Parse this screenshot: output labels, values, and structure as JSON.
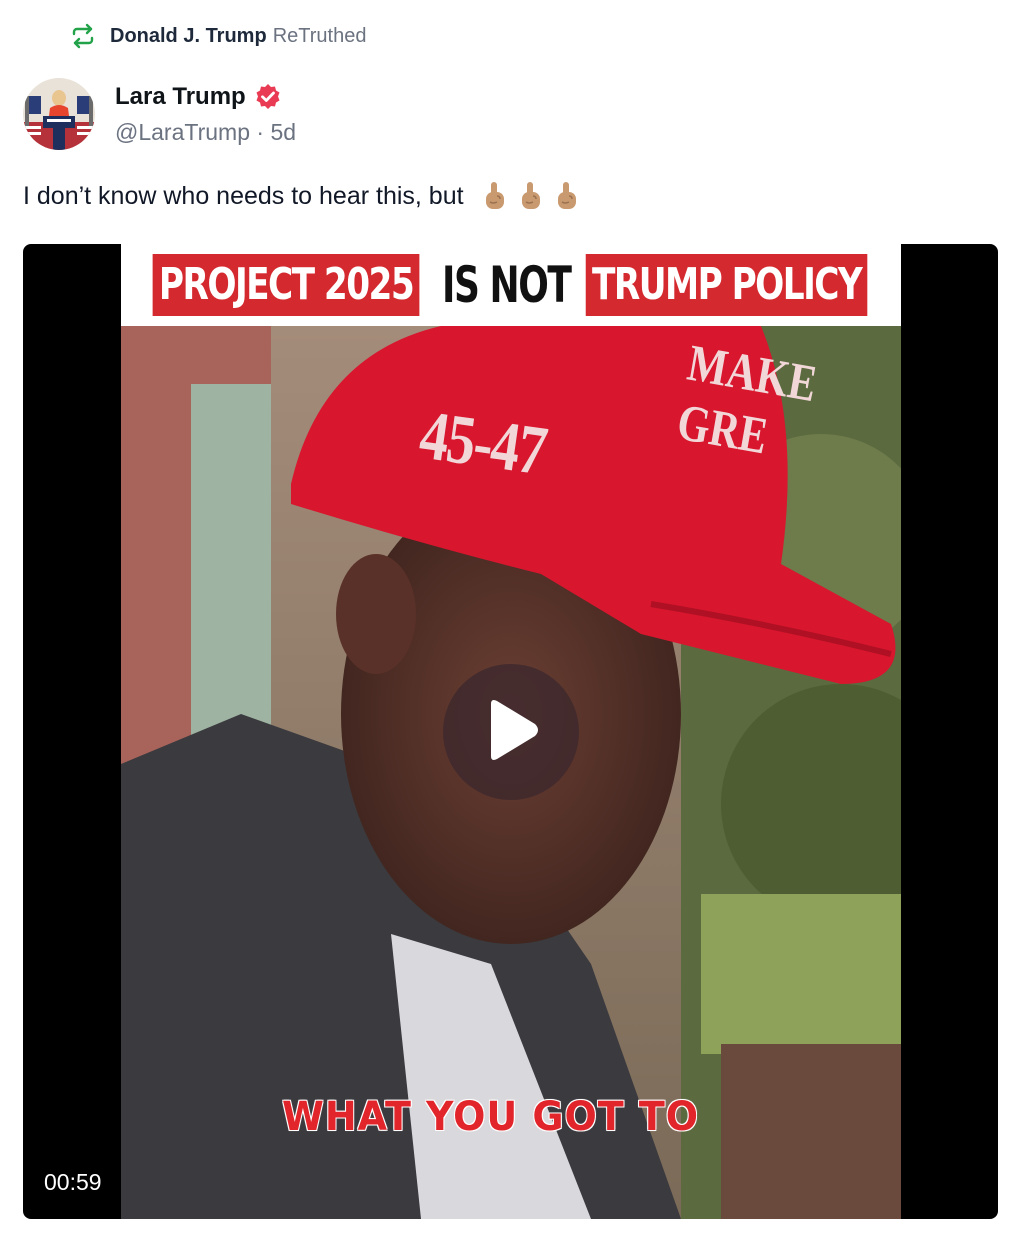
{
  "retruth": {
    "name": "Donald J. Trump",
    "suffix": "ReTruthed"
  },
  "post": {
    "author_name": "Lara Trump",
    "handle": "@LaraTrump",
    "separator": "·",
    "age": "5d",
    "text": "I don’t know who needs to hear this, but",
    "emojis": [
      "point-up-hand",
      "point-up-hand",
      "point-up-hand"
    ]
  },
  "video": {
    "banner_left": "PROJECT 2025",
    "banner_mid": "IS NOT",
    "banner_right": "TRUMP POLICY",
    "hat_number": "45-47",
    "hat_text": "MAKE\nGRE",
    "caption": "WHAT YOU GOT TO",
    "duration": "00:59"
  },
  "colors": {
    "retruth_icon": "#22a34a",
    "verified": "#e93b54",
    "banner_red": "#d42a2f",
    "hat_red": "#d8162e"
  },
  "icons": {
    "retruth": "repost-icon",
    "verified": "verified-badge-icon",
    "play": "play-icon"
  }
}
